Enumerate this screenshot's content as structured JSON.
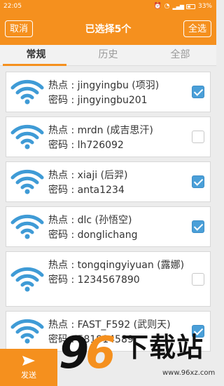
{
  "status_bar": {
    "time": "22:05",
    "battery": "33%"
  },
  "header": {
    "cancel_label": "取消",
    "title": "已选择5个",
    "select_all_label": "全选"
  },
  "tabs": [
    {
      "label": "常规",
      "active": true
    },
    {
      "label": "历史",
      "active": false
    },
    {
      "label": "全部",
      "active": false
    }
  ],
  "hotspots": [
    {
      "ssid_line": "热点 : jingyingbu (项羽)",
      "password_line": "密码 : jingyingbu201",
      "checked": true
    },
    {
      "ssid_line": "热点 : mrdn (成吉思汗)",
      "password_line": "密码 : lh726092",
      "checked": false
    },
    {
      "ssid_line": "热点 : xiaji (后羿)",
      "password_line": "密码 : anta1234",
      "checked": true
    },
    {
      "ssid_line": "热点 : dlc (孙悟空)",
      "password_line": "密码 : donglichang",
      "checked": true
    },
    {
      "ssid_line": "热点 : tongqingyiyuan (露娜)",
      "password_line": "密码 : 1234567890",
      "checked": false
    },
    {
      "ssid_line": "热点 : FAST_F592 (武则天)",
      "password_line": "密码 : 581914589",
      "checked": true
    }
  ],
  "send_label": "发送",
  "watermark": {
    "number": "96",
    "brand": "下载站",
    "url": "www.96xz.com"
  },
  "colors": {
    "accent": "#f5901e",
    "wifi_icon": "#3f9bd6",
    "checkbox": "#4a9fd8"
  }
}
